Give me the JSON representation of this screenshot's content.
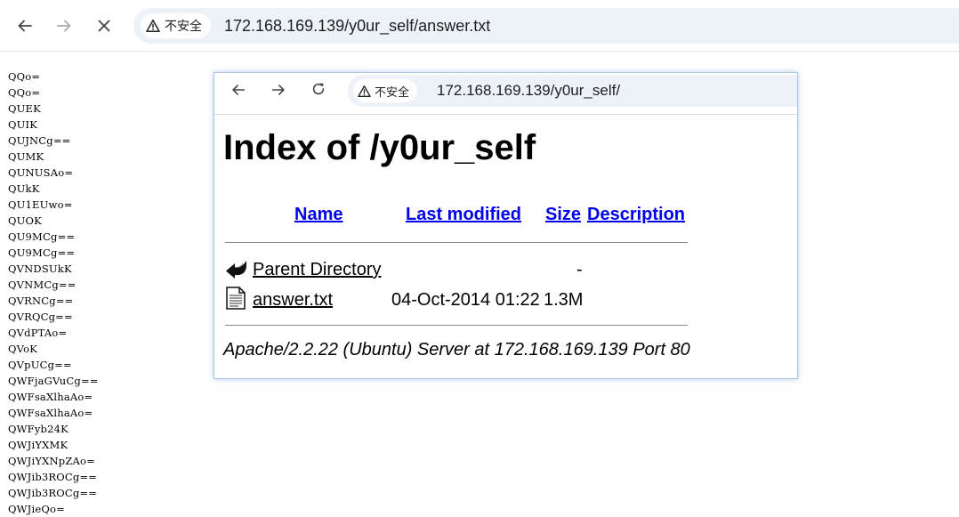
{
  "browser": {
    "security_label": "不安全",
    "url": "172.168.169.139/y0ur_self/answer.txt"
  },
  "file_lines": [
    "QQo=",
    "QQo=",
    "QUEK",
    "QUIK",
    "QUJNCg==",
    "QUMK",
    "QUNUSAo=",
    "QUkK",
    "QU1EUwo=",
    "QUOK",
    "QU9MCg==",
    "QU9MCg==",
    "QVNDSUkK",
    "QVNMCg==",
    "QVRNCg==",
    "QVRQCg==",
    "QVdPTAo=",
    "QVoK",
    "QVpUCg==",
    "QWFjaGVuCg==",
    "QWFsaXlhaAo=",
    "QWFsaXlhaAo=",
    "QWFyb24K",
    "QWJiYXMK",
    "QWJiYXNpZAo=",
    "QWJib3ROCg==",
    "QWJib3ROCg==",
    "QWJieQo="
  ],
  "inner_screenshot": {
    "security_label": "不安全",
    "url": "172.168.169.139/y0ur_self/",
    "title": "Index of /y0ur_self",
    "columns": {
      "name": "Name",
      "last_modified": "Last modified",
      "size": "Size",
      "description": "Description"
    },
    "rows": [
      {
        "name": "Parent Directory",
        "modified": "",
        "size": "-",
        "icon": "back-arrow-icon"
      },
      {
        "name": "answer.txt",
        "modified": "04-Oct-2014 01:22",
        "size": "1.3M",
        "icon": "text-file-icon"
      }
    ],
    "footer": "Apache/2.2.22 (Ubuntu) Server at 172.168.169.139 Port 80"
  }
}
